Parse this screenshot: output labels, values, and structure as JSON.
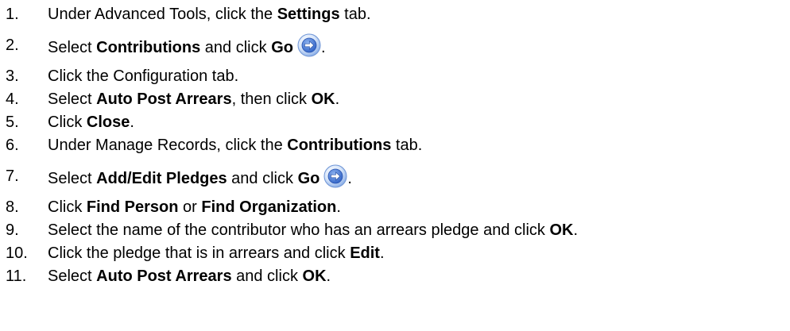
{
  "steps": [
    {
      "num": "1.",
      "parts": [
        {
          "t": "Under Advanced Tools, click the "
        },
        {
          "t": "Settings",
          "b": true
        },
        {
          "t": " tab."
        }
      ]
    },
    {
      "num": "2.",
      "parts": [
        {
          "t": "Select "
        },
        {
          "t": "Contributions",
          "b": true
        },
        {
          "t": " and click "
        },
        {
          "t": "Go",
          "b": true
        },
        {
          "icon": "go-arrow-icon"
        },
        {
          "t": "."
        }
      ]
    },
    {
      "num": "3.",
      "parts": [
        {
          "t": "Click the Configuration tab."
        }
      ]
    },
    {
      "num": "4.",
      "parts": [
        {
          "t": "Select "
        },
        {
          "t": "Auto Post Arrears",
          "b": true
        },
        {
          "t": ", then click "
        },
        {
          "t": "OK",
          "b": true
        },
        {
          "t": "."
        }
      ]
    },
    {
      "num": "5.",
      "parts": [
        {
          "t": "Click "
        },
        {
          "t": "Close",
          "b": true
        },
        {
          "t": "."
        }
      ]
    },
    {
      "num": "6.",
      "parts": [
        {
          "t": "Under Manage Records, click the "
        },
        {
          "t": "Contributions",
          "b": true
        },
        {
          "t": " tab."
        }
      ]
    },
    {
      "num": "7.",
      "parts": [
        {
          "t": "Select "
        },
        {
          "t": "Add/Edit Pledges",
          "b": true
        },
        {
          "t": " and click "
        },
        {
          "t": "Go",
          "b": true
        },
        {
          "icon": "go-arrow-icon"
        },
        {
          "t": "."
        }
      ]
    },
    {
      "num": "8.",
      "parts": [
        {
          "t": "Click "
        },
        {
          "t": "Find Person",
          "b": true
        },
        {
          "t": " or "
        },
        {
          "t": "Find Organization",
          "b": true
        },
        {
          "t": "."
        }
      ]
    },
    {
      "num": "9.",
      "parts": [
        {
          "t": "Select the name of the contributor who has an arrears pledge and click "
        },
        {
          "t": "OK",
          "b": true
        },
        {
          "t": "."
        }
      ]
    },
    {
      "num": "10.",
      "parts": [
        {
          "t": "Click the pledge that is in arrears and click "
        },
        {
          "t": "Edit",
          "b": true
        },
        {
          "t": "."
        }
      ]
    },
    {
      "num": "11.",
      "parts": [
        {
          "t": "Select "
        },
        {
          "t": "Auto Post Arrears",
          "b": true
        },
        {
          "t": " and click "
        },
        {
          "t": "OK",
          "b": true
        },
        {
          "t": "."
        }
      ]
    }
  ],
  "colors": {
    "text": "#000000",
    "background": "#ffffff",
    "icon_blue": "#3a6fd0",
    "icon_light": "#bcd3f4"
  }
}
